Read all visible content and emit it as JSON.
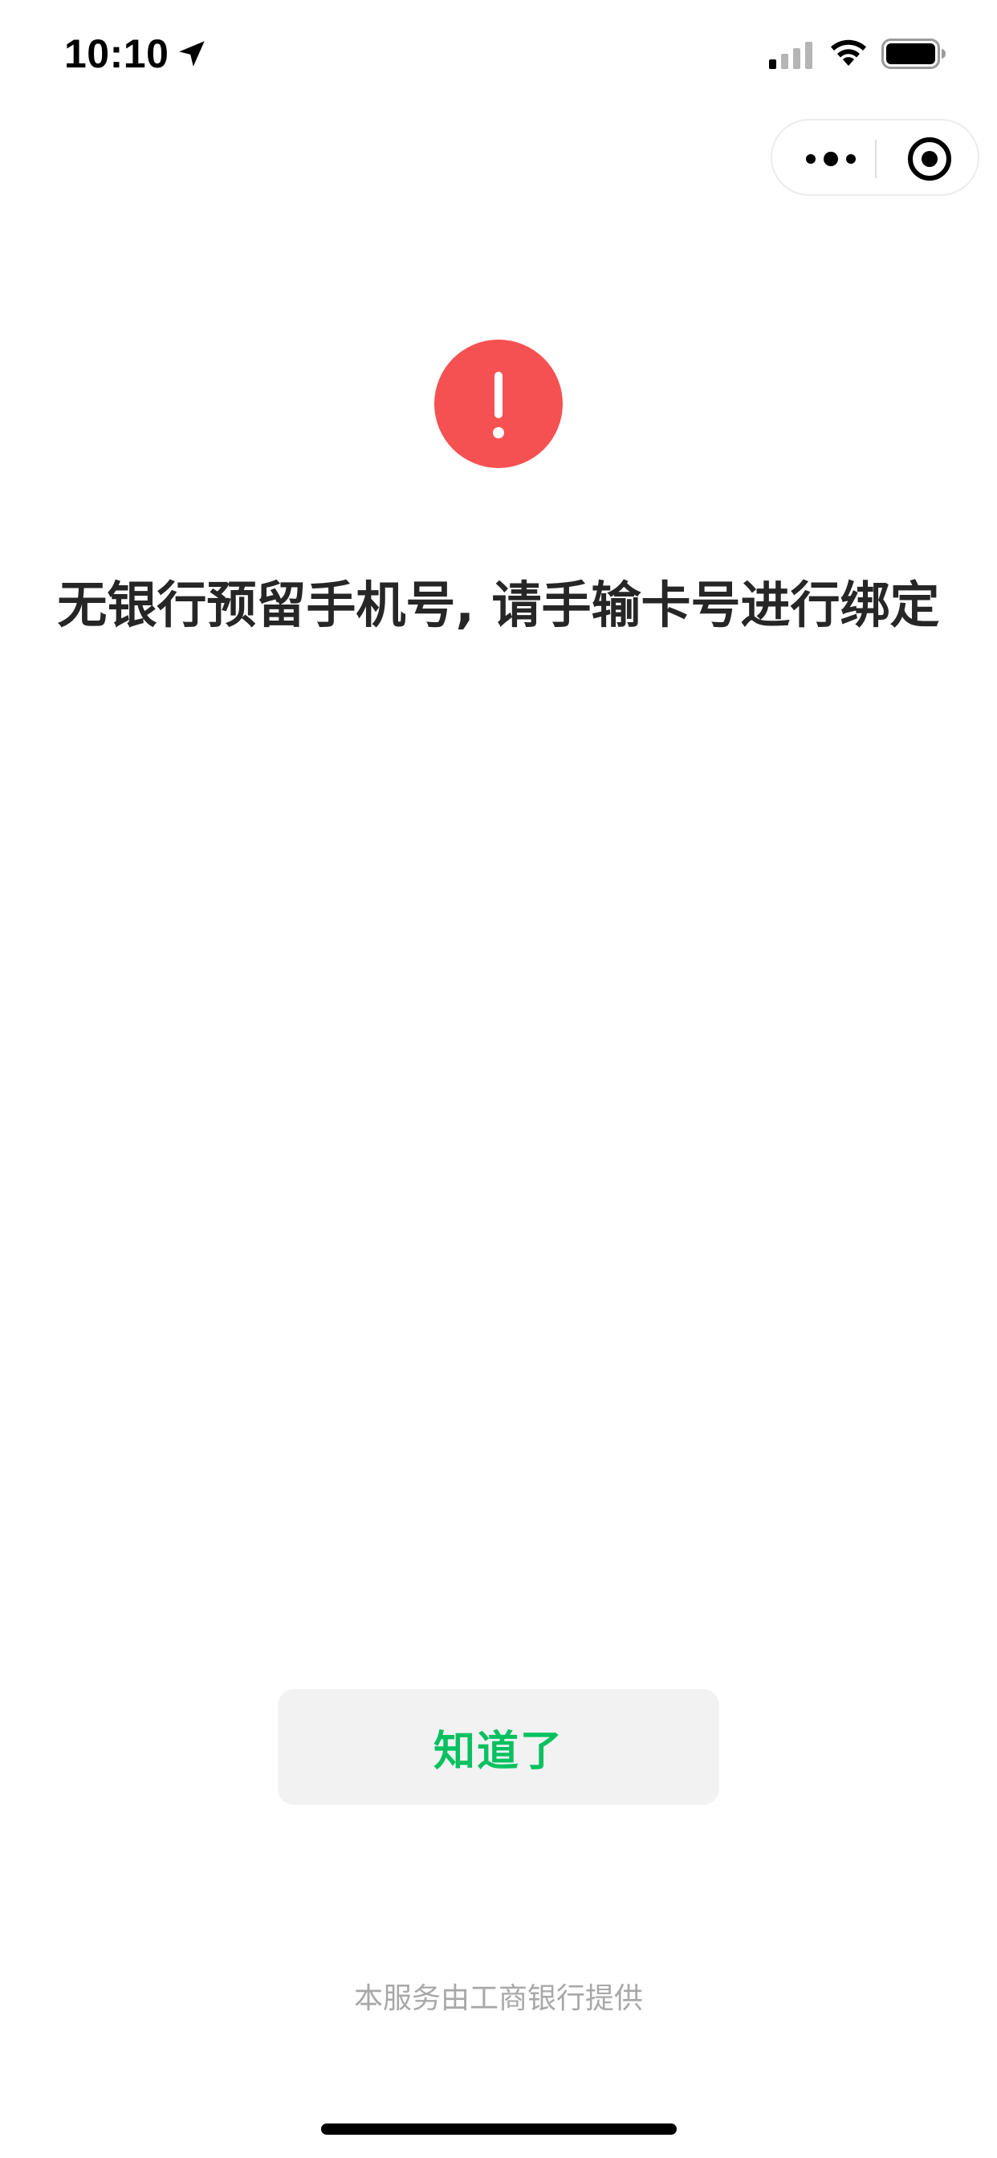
{
  "status_bar": {
    "time": "10:10",
    "icons": [
      "location-arrow-icon",
      "cellular-signal-icon",
      "wifi-icon",
      "battery-icon"
    ]
  },
  "capsule_menu": {
    "icons": [
      "more-dots-icon",
      "close-target-icon"
    ]
  },
  "alert": {
    "icon": "exclamation-icon",
    "color": "#f65152",
    "message": "无银行预留手机号, 请手输卡号进行绑定"
  },
  "actions": {
    "ok_label": "知道了",
    "ok_color": "#07c160"
  },
  "footer": {
    "provider_text": "本服务由工商银行提供"
  }
}
